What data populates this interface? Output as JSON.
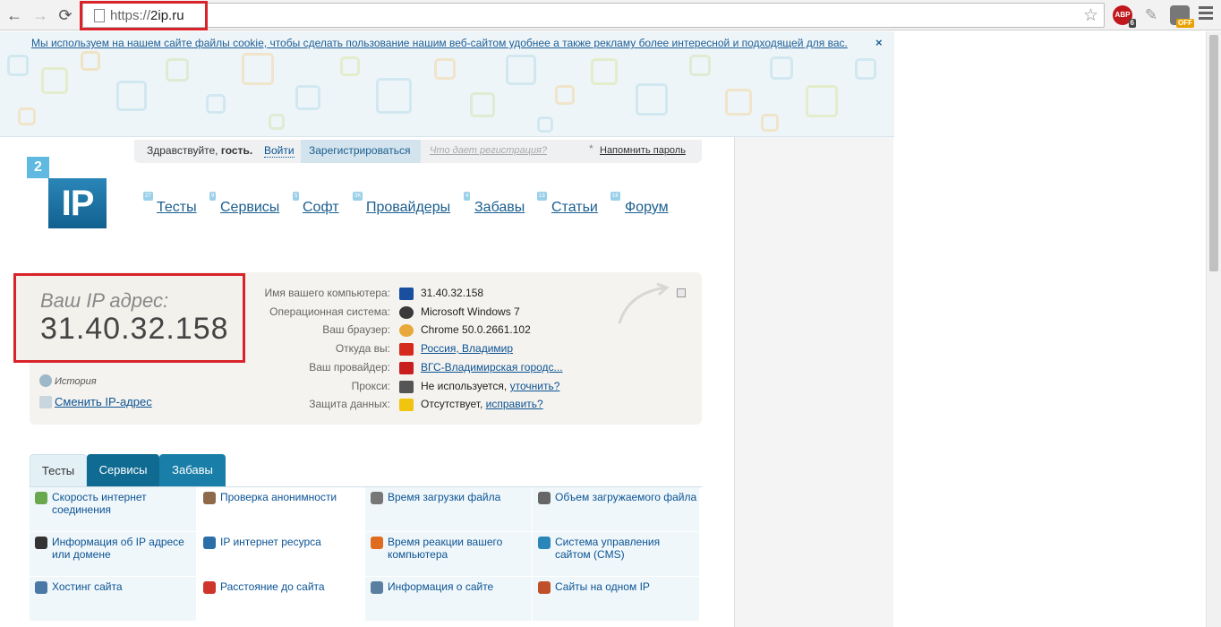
{
  "browser": {
    "url_scheme": "https://",
    "url_host": "2ip.ru",
    "abp_label": "ABP",
    "abp_badge": "6",
    "ext_badge": "OFF"
  },
  "cookie_notice": {
    "text": "Мы используем на нашем сайте файлы cookie, чтобы сделать пользование нашим веб-сайтом удобнее а также рекламу более интересной и подходящей для вас.",
    "close": "×"
  },
  "login_bar": {
    "greeting": "Здравствуйте,",
    "guest": "гость.",
    "login": "Войти",
    "register": "Зарегистрироваться",
    "why_register": "Что дает регистрация?",
    "asterisk": "*",
    "remind_password": "Напомнить пароль"
  },
  "logo": {
    "small": "2",
    "big": "IP"
  },
  "nav": [
    {
      "label": "Тесты",
      "badge": "27"
    },
    {
      "label": "Сервисы",
      "badge": "9"
    },
    {
      "label": "Софт",
      "badge": "5"
    },
    {
      "label": "Провайдеры",
      "badge": "3K"
    },
    {
      "label": "Забавы",
      "badge": "4"
    },
    {
      "label": "Статьи",
      "badge": "13"
    },
    {
      "label": "Форум",
      "badge": "16"
    }
  ],
  "ip_panel": {
    "label": "Ваш IP адрес:",
    "address": "31.40.32.158",
    "history": "История",
    "change_ip": "Сменить IP-адрес",
    "rows": [
      {
        "label": "Имя вашего компьютера:",
        "value": "31.40.32.158",
        "link": "",
        "icon": "computer-icon",
        "color": "#1a4fa0"
      },
      {
        "label": "Операционная система:",
        "value": "Microsoft Windows 7",
        "link": "",
        "icon": "windows-icon",
        "color": "#3a3a3a"
      },
      {
        "label": "Ваш браузер:",
        "value": "Chrome 50.0.2661.102",
        "link": "",
        "icon": "chrome-icon",
        "color": "#e8a93c"
      },
      {
        "label": "Откуда вы:",
        "value": "",
        "link": "Россия, Владимир",
        "icon": "flag-russia-icon",
        "color": "#d52b1e"
      },
      {
        "label": "Ваш провайдер:",
        "value": "",
        "link": "ВГС-Владимирская городс...",
        "icon": "provider-icon",
        "color": "#c81e1e"
      },
      {
        "label": "Прокси:",
        "value": "Не используется,",
        "link": "уточнить?",
        "icon": "glasses-icon",
        "color": "#555555"
      },
      {
        "label": "Защита данных:",
        "value": "Отсутствует,",
        "link": "исправить?",
        "icon": "warning-icon",
        "color": "#f1c40f"
      }
    ]
  },
  "tabs": [
    {
      "label": "Тесты"
    },
    {
      "label": "Сервисы"
    },
    {
      "label": "Забавы"
    }
  ],
  "tests_grid": [
    {
      "label": "Скорость интернет соединения",
      "icon": "speed-icon",
      "color": "#6aa84f"
    },
    {
      "label": "Проверка анонимности",
      "icon": "anonymity-icon",
      "color": "#8e6a4a"
    },
    {
      "label": "Время загрузки файла",
      "icon": "clock-icon",
      "color": "#777777"
    },
    {
      "label": "Объем загружаемого файла",
      "icon": "file-size-icon",
      "color": "#666666"
    },
    {
      "label": "Информация об IP адресе или домене",
      "icon": "ip-info-icon",
      "color": "#333333"
    },
    {
      "label": "IP интернет ресурса",
      "icon": "ip-resource-icon",
      "color": "#2a6fa8"
    },
    {
      "label": "Время реакции вашего компьютера",
      "icon": "reaction-icon",
      "color": "#e06c1f"
    },
    {
      "label": "Система управления сайтом (CMS)",
      "icon": "cms-icon",
      "color": "#2a86b8"
    },
    {
      "label": "Хостинг сайта",
      "icon": "hosting-icon",
      "color": "#4a79a5"
    },
    {
      "label": "Расстояние до сайта",
      "icon": "map-pin-icon",
      "color": "#d0352b"
    },
    {
      "label": "Информация о сайте",
      "icon": "site-info-icon",
      "color": "#5a7fa0"
    },
    {
      "label": "Сайты на одном IP",
      "icon": "sites-icon",
      "color": "#c0502a"
    }
  ]
}
